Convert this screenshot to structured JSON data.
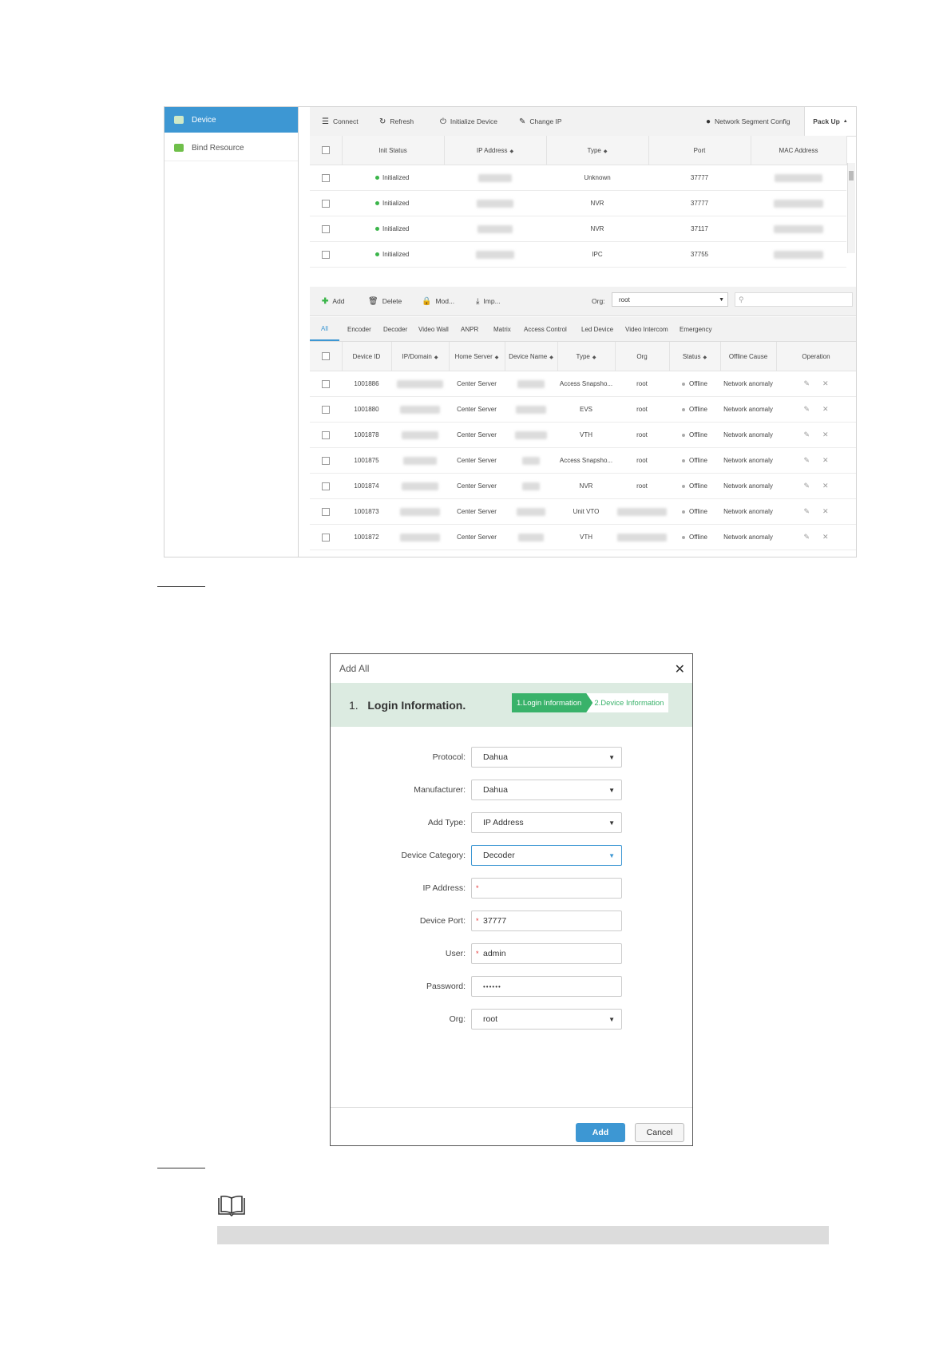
{
  "sidebar": {
    "items": [
      {
        "label": "Device",
        "active": true
      },
      {
        "label": "Bind Resource",
        "active": false
      }
    ]
  },
  "top_toolbar": {
    "connect": "Connect",
    "refresh": "Refresh",
    "initialize": "Initialize Device",
    "change_ip": "Change IP",
    "network_segment": "Network Segment Config",
    "pack_up": "Pack Up"
  },
  "init_table": {
    "headers": {
      "init_status": "Init Status",
      "ip": "IP Address",
      "type": "Type",
      "port": "Port",
      "mac": "MAC Address"
    },
    "rows": [
      {
        "status": "Initialized",
        "type": "Unknown",
        "port": "37777"
      },
      {
        "status": "Initialized",
        "type": "NVR",
        "port": "37777"
      },
      {
        "status": "Initialized",
        "type": "NVR",
        "port": "37117"
      },
      {
        "status": "Initialized",
        "type": "IPC",
        "port": "37755"
      }
    ]
  },
  "device_toolbar": {
    "add": "Add",
    "delete": "Delete",
    "modify": "Mod...",
    "import": "Imp...",
    "org_label": "Org:",
    "org_value": "root"
  },
  "tabs": [
    "All",
    "Encoder",
    "Decoder",
    "Video Wall",
    "ANPR",
    "Matrix",
    "Access Control",
    "Led Device",
    "Video Intercom",
    "Emergency"
  ],
  "device_table": {
    "headers": {
      "id": "Device ID",
      "ip": "IP/Domain",
      "home": "Home Server",
      "name": "Device Name",
      "type": "Type",
      "org": "Org",
      "status": "Status",
      "cause": "Offline Cause",
      "operation": "Operation"
    },
    "rows": [
      {
        "id": "1001886",
        "home": "Center Server",
        "type": "Access Snapsho...",
        "org": "root",
        "status": "Offline",
        "cause": "Network anomaly"
      },
      {
        "id": "1001880",
        "home": "Center Server",
        "type": "EVS",
        "org": "root",
        "status": "Offline",
        "cause": "Network anomaly"
      },
      {
        "id": "1001878",
        "home": "Center Server",
        "type": "VTH",
        "org": "root",
        "status": "Offline",
        "cause": "Network anomaly"
      },
      {
        "id": "1001875",
        "home": "Center Server",
        "type": "Access Snapsho...",
        "org": "root",
        "status": "Offline",
        "cause": "Network anomaly"
      },
      {
        "id": "1001874",
        "home": "Center Server",
        "type": "NVR",
        "org": "root",
        "status": "Offline",
        "cause": "Network anomaly"
      },
      {
        "id": "1001873",
        "home": "Center Server",
        "type": "Unit VTO",
        "org": "",
        "status": "Offline",
        "cause": "Network anomaly"
      },
      {
        "id": "1001872",
        "home": "Center Server",
        "type": "VTH",
        "org": "",
        "status": "Offline",
        "cause": "Network anomaly"
      }
    ]
  },
  "dialog": {
    "title": "Add All",
    "step_number": "1.",
    "step_title": "Login Information.",
    "steps": [
      "1.Login Information",
      "2.Device Information"
    ],
    "fields": {
      "protocol": {
        "label": "Protocol:",
        "value": "Dahua"
      },
      "manufacturer": {
        "label": "Manufacturer:",
        "value": "Dahua"
      },
      "add_type": {
        "label": "Add Type:",
        "value": "IP Address"
      },
      "category": {
        "label": "Device Category:",
        "value": "Decoder"
      },
      "ip": {
        "label": "IP Address:",
        "value": ""
      },
      "port": {
        "label": "Device Port:",
        "value": "37777"
      },
      "user": {
        "label": "User:",
        "value": "admin"
      },
      "password": {
        "label": "Password:",
        "value": "••••••"
      },
      "org": {
        "label": "Org:",
        "value": "root"
      }
    },
    "add_button": "Add",
    "cancel_button": "Cancel"
  }
}
